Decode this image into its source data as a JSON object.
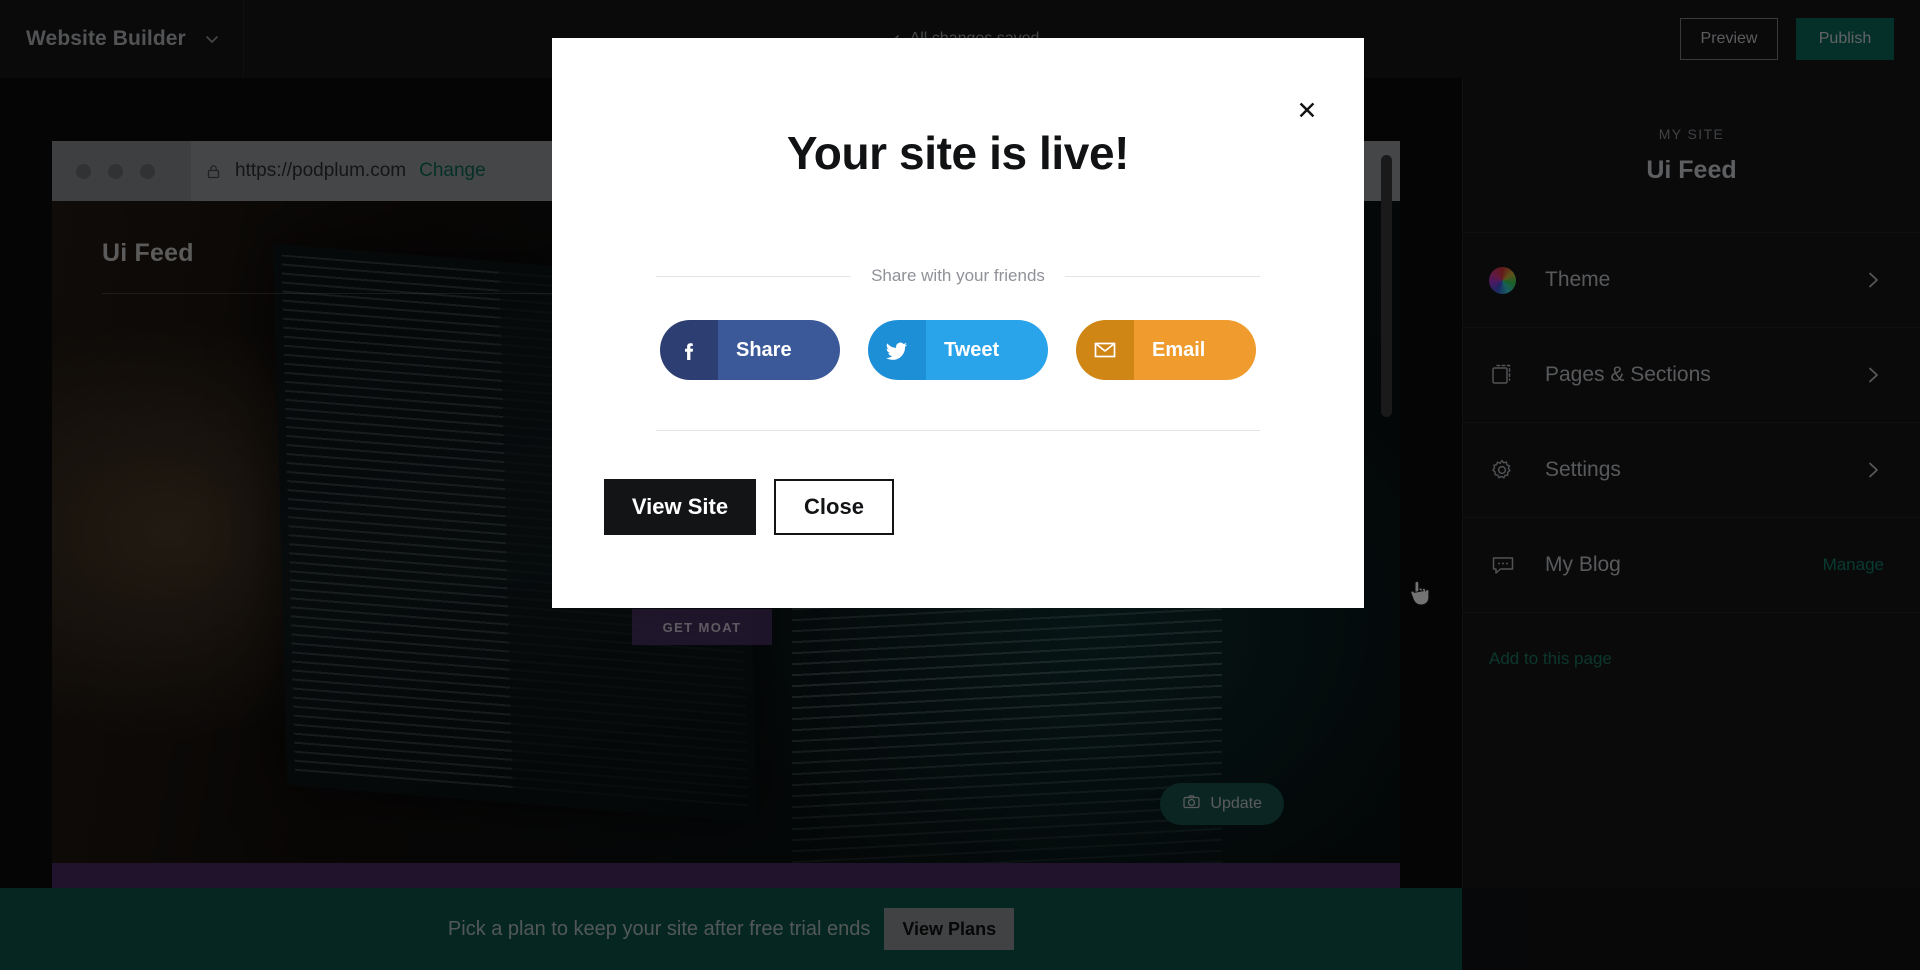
{
  "topbar": {
    "brand": "Website Builder",
    "brand_caret_icon": "chevron-down-icon",
    "save_status": "All changes saved",
    "save_status_icon": "check-icon",
    "preview_label": "Preview",
    "publish_label": "Publish",
    "publish_color": "#0b6b5b"
  },
  "preview": {
    "dots_icon": "traffic-light-dots-icon",
    "lock_icon": "lock-icon",
    "url": "https://podplum.com",
    "change_label": "Change",
    "change_color": "#0d6b55",
    "site_title": "Ui Feed",
    "cta_label": "GET MOAT",
    "update_label": "Update",
    "update_icon": "camera-icon",
    "scrollbar_icon": "vertical-scrollbar"
  },
  "sidebar": {
    "eyebrow": "MY SITE",
    "site_name": "Ui Feed",
    "items": [
      {
        "label": "Theme",
        "icon": "color-wheel-icon",
        "accessory": "chevron-right-icon",
        "accessory_label": ""
      },
      {
        "label": "Pages & Sections",
        "icon": "pages-icon",
        "accessory": "chevron-right-icon",
        "accessory_label": ""
      },
      {
        "label": "Settings",
        "icon": "gear-icon",
        "accessory": "chevron-right-icon",
        "accessory_label": ""
      },
      {
        "label": "My Blog",
        "icon": "speech-bubble-icon",
        "accessory": "text",
        "accessory_label": "Manage"
      }
    ],
    "add_link": "Add to this page",
    "link_color": "#1c7a62"
  },
  "trialbar": {
    "message": "Pick a plan to keep your site after free trial ends",
    "button_label": "View Plans",
    "background": "#0d5449"
  },
  "modal": {
    "close_icon": "close-icon",
    "title": "Your site is live!",
    "divider_label": "Share with your friends",
    "share_buttons": [
      {
        "label": "Share",
        "icon": "facebook-icon",
        "color": "#3b5998"
      },
      {
        "label": "Tweet",
        "icon": "twitter-icon",
        "color": "#29a3ea"
      },
      {
        "label": "Email",
        "icon": "envelope-icon",
        "color": "#f09b2e"
      }
    ],
    "primary_label": "View Site",
    "secondary_label": "Close"
  },
  "cursor": {
    "icon": "pointer-hand-cursor"
  }
}
